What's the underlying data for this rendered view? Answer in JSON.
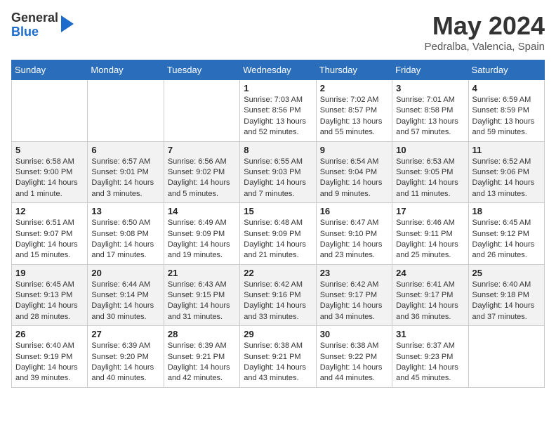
{
  "logo": {
    "line1": "General",
    "line2": "Blue"
  },
  "title": "May 2024",
  "location": "Pedralba, Valencia, Spain",
  "days_header": [
    "Sunday",
    "Monday",
    "Tuesday",
    "Wednesday",
    "Thursday",
    "Friday",
    "Saturday"
  ],
  "weeks": [
    [
      {
        "day": "",
        "info": ""
      },
      {
        "day": "",
        "info": ""
      },
      {
        "day": "",
        "info": ""
      },
      {
        "day": "1",
        "info": "Sunrise: 7:03 AM\nSunset: 8:56 PM\nDaylight: 13 hours\nand 52 minutes."
      },
      {
        "day": "2",
        "info": "Sunrise: 7:02 AM\nSunset: 8:57 PM\nDaylight: 13 hours\nand 55 minutes."
      },
      {
        "day": "3",
        "info": "Sunrise: 7:01 AM\nSunset: 8:58 PM\nDaylight: 13 hours\nand 57 minutes."
      },
      {
        "day": "4",
        "info": "Sunrise: 6:59 AM\nSunset: 8:59 PM\nDaylight: 13 hours\nand 59 minutes."
      }
    ],
    [
      {
        "day": "5",
        "info": "Sunrise: 6:58 AM\nSunset: 9:00 PM\nDaylight: 14 hours\nand 1 minute."
      },
      {
        "day": "6",
        "info": "Sunrise: 6:57 AM\nSunset: 9:01 PM\nDaylight: 14 hours\nand 3 minutes."
      },
      {
        "day": "7",
        "info": "Sunrise: 6:56 AM\nSunset: 9:02 PM\nDaylight: 14 hours\nand 5 minutes."
      },
      {
        "day": "8",
        "info": "Sunrise: 6:55 AM\nSunset: 9:03 PM\nDaylight: 14 hours\nand 7 minutes."
      },
      {
        "day": "9",
        "info": "Sunrise: 6:54 AM\nSunset: 9:04 PM\nDaylight: 14 hours\nand 9 minutes."
      },
      {
        "day": "10",
        "info": "Sunrise: 6:53 AM\nSunset: 9:05 PM\nDaylight: 14 hours\nand 11 minutes."
      },
      {
        "day": "11",
        "info": "Sunrise: 6:52 AM\nSunset: 9:06 PM\nDaylight: 14 hours\nand 13 minutes."
      }
    ],
    [
      {
        "day": "12",
        "info": "Sunrise: 6:51 AM\nSunset: 9:07 PM\nDaylight: 14 hours\nand 15 minutes."
      },
      {
        "day": "13",
        "info": "Sunrise: 6:50 AM\nSunset: 9:08 PM\nDaylight: 14 hours\nand 17 minutes."
      },
      {
        "day": "14",
        "info": "Sunrise: 6:49 AM\nSunset: 9:09 PM\nDaylight: 14 hours\nand 19 minutes."
      },
      {
        "day": "15",
        "info": "Sunrise: 6:48 AM\nSunset: 9:09 PM\nDaylight: 14 hours\nand 21 minutes."
      },
      {
        "day": "16",
        "info": "Sunrise: 6:47 AM\nSunset: 9:10 PM\nDaylight: 14 hours\nand 23 minutes."
      },
      {
        "day": "17",
        "info": "Sunrise: 6:46 AM\nSunset: 9:11 PM\nDaylight: 14 hours\nand 25 minutes."
      },
      {
        "day": "18",
        "info": "Sunrise: 6:45 AM\nSunset: 9:12 PM\nDaylight: 14 hours\nand 26 minutes."
      }
    ],
    [
      {
        "day": "19",
        "info": "Sunrise: 6:45 AM\nSunset: 9:13 PM\nDaylight: 14 hours\nand 28 minutes."
      },
      {
        "day": "20",
        "info": "Sunrise: 6:44 AM\nSunset: 9:14 PM\nDaylight: 14 hours\nand 30 minutes."
      },
      {
        "day": "21",
        "info": "Sunrise: 6:43 AM\nSunset: 9:15 PM\nDaylight: 14 hours\nand 31 minutes."
      },
      {
        "day": "22",
        "info": "Sunrise: 6:42 AM\nSunset: 9:16 PM\nDaylight: 14 hours\nand 33 minutes."
      },
      {
        "day": "23",
        "info": "Sunrise: 6:42 AM\nSunset: 9:17 PM\nDaylight: 14 hours\nand 34 minutes."
      },
      {
        "day": "24",
        "info": "Sunrise: 6:41 AM\nSunset: 9:17 PM\nDaylight: 14 hours\nand 36 minutes."
      },
      {
        "day": "25",
        "info": "Sunrise: 6:40 AM\nSunset: 9:18 PM\nDaylight: 14 hours\nand 37 minutes."
      }
    ],
    [
      {
        "day": "26",
        "info": "Sunrise: 6:40 AM\nSunset: 9:19 PM\nDaylight: 14 hours\nand 39 minutes."
      },
      {
        "day": "27",
        "info": "Sunrise: 6:39 AM\nSunset: 9:20 PM\nDaylight: 14 hours\nand 40 minutes."
      },
      {
        "day": "28",
        "info": "Sunrise: 6:39 AM\nSunset: 9:21 PM\nDaylight: 14 hours\nand 42 minutes."
      },
      {
        "day": "29",
        "info": "Sunrise: 6:38 AM\nSunset: 9:21 PM\nDaylight: 14 hours\nand 43 minutes."
      },
      {
        "day": "30",
        "info": "Sunrise: 6:38 AM\nSunset: 9:22 PM\nDaylight: 14 hours\nand 44 minutes."
      },
      {
        "day": "31",
        "info": "Sunrise: 6:37 AM\nSunset: 9:23 PM\nDaylight: 14 hours\nand 45 minutes."
      },
      {
        "day": "",
        "info": ""
      }
    ]
  ]
}
